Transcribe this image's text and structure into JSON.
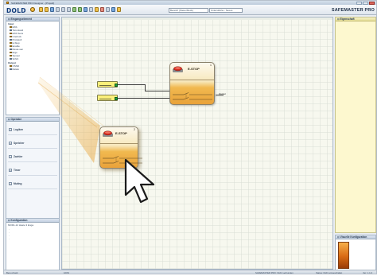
{
  "window": {
    "title": "SAFEMASTER PRO Designer - [Projekt]"
  },
  "toolbar": {
    "logo": "DOLD",
    "search_placeholder": "Bereich (Steuerblock)",
    "language_value": "Unterstützte - Nexus",
    "brand": "SAFEMASTER PRO",
    "icons": [
      "new-icon",
      "open-icon",
      "save-icon",
      "cut-icon",
      "copy-icon",
      "paste-icon",
      "undo-icon",
      "redo-icon",
      "zoom-icon",
      "grid-icon",
      "align-icon",
      "delete-icon",
      "print-icon",
      "settings-icon",
      "help-icon"
    ]
  },
  "left_panel": {
    "elements_title": "Eingangselement",
    "items": [
      {
        "label": "Input",
        "head": true
      },
      {
        "label": "ESS"
      },
      {
        "label": "Two-Hand"
      },
      {
        "label": "ESS Sens"
      },
      {
        "label": "Interlock"
      },
      {
        "label": "Protokoll"
      },
      {
        "label": "E-Stop"
      },
      {
        "label": "Enable"
      },
      {
        "label": "Reset-sen"
      },
      {
        "label": "Erge"
      },
      {
        "label": "Sensor"
      },
      {
        "label": "Schrit"
      },
      {
        "label": "Output",
        "head": true
      },
      {
        "label": "OSSD"
      },
      {
        "label": "Relais"
      }
    ],
    "operators_title": "Operator",
    "operator_groups": [
      "Logiken",
      "Speicher",
      "Zaehler",
      "Timer",
      "Muting"
    ],
    "config_title": "Konfiguration",
    "config_text": "MOD1-12 Haste 3 Enga",
    "config_dots": [
      "-",
      "-",
      "-",
      "-"
    ]
  },
  "right_panel": {
    "title": "Eigenschaft",
    "lower_title": "Visuelle Konfiguration"
  },
  "canvas": {
    "blocks": [
      {
        "id": "placed",
        "title": "E-STOP",
        "number": "1",
        "output_label": "Output"
      },
      {
        "id": "dragged",
        "title": "E-STOP",
        "number": "2"
      }
    ]
  },
  "statusbar": {
    "left": "Benu Zustd",
    "zoom": "100%",
    "right1": "SAFEMASTER PRO: Nicht verbunden",
    "right2": "Status: Nicht eingeschaltet",
    "version": "Ver: 1.1.0"
  }
}
